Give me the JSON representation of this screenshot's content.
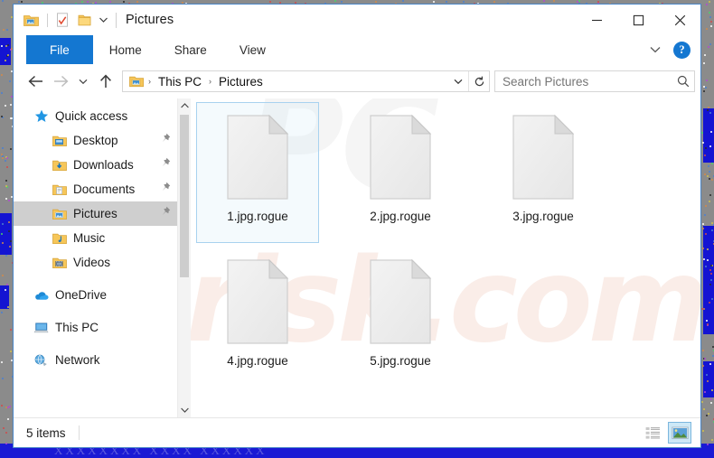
{
  "window": {
    "title": "Pictures",
    "quick_access_toolbar": [
      {
        "name": "pictures-folder-icon",
        "label": "Pictures"
      },
      {
        "name": "properties-icon",
        "label": "Properties"
      },
      {
        "name": "new-folder-icon",
        "label": "New folder"
      },
      {
        "name": "customize-caret-icon",
        "label": "Customize Quick Access Toolbar"
      }
    ],
    "controls": {
      "minimize": "–",
      "maximize": "□",
      "close": "✕"
    }
  },
  "ribbon": {
    "tabs": [
      {
        "label": "File",
        "active": true
      },
      {
        "label": "Home",
        "active": false
      },
      {
        "label": "Share",
        "active": false
      },
      {
        "label": "View",
        "active": false
      }
    ],
    "expand_label": "⌄",
    "help_label": "?"
  },
  "addressbar": {
    "back_label": "←",
    "forward_label": "→",
    "recent_label": "⌄",
    "up_label": "↑",
    "breadcrumb": [
      {
        "label": "This PC"
      },
      {
        "label": "Pictures"
      }
    ],
    "separator": "›",
    "dropdown_label": "⌄",
    "refresh_label": "↻"
  },
  "search": {
    "placeholder": "Search Pictures",
    "value": "",
    "icon": "search-icon"
  },
  "sidebar": {
    "items": [
      {
        "label": "Quick access",
        "icon": "star-icon",
        "indent": false,
        "pinned": false,
        "selected": false
      },
      {
        "label": "Desktop",
        "icon": "desktop-folder-icon",
        "indent": true,
        "pinned": true,
        "selected": false
      },
      {
        "label": "Downloads",
        "icon": "downloads-folder-icon",
        "indent": true,
        "pinned": true,
        "selected": false
      },
      {
        "label": "Documents",
        "icon": "documents-folder-icon",
        "indent": true,
        "pinned": true,
        "selected": false
      },
      {
        "label": "Pictures",
        "icon": "pictures-folder-icon",
        "indent": true,
        "pinned": true,
        "selected": true
      },
      {
        "label": "Music",
        "icon": "music-folder-icon",
        "indent": true,
        "pinned": false,
        "selected": false
      },
      {
        "label": "Videos",
        "icon": "videos-folder-icon",
        "indent": true,
        "pinned": false,
        "selected": false
      },
      {
        "label": "OneDrive",
        "icon": "onedrive-cloud-icon",
        "indent": false,
        "pinned": false,
        "selected": false,
        "gap_before": true
      },
      {
        "label": "This PC",
        "icon": "this-pc-icon",
        "indent": false,
        "pinned": false,
        "selected": false,
        "gap_before": true
      },
      {
        "label": "Network",
        "icon": "network-icon",
        "indent": false,
        "pinned": false,
        "selected": false,
        "gap_before": true
      }
    ],
    "scroll_up": "⌃",
    "scroll_down": "⌄"
  },
  "files": [
    {
      "name": "1.jpg.rogue",
      "icon": "blank-document-icon",
      "selected": true
    },
    {
      "name": "2.jpg.rogue",
      "icon": "blank-document-icon",
      "selected": false
    },
    {
      "name": "3.jpg.rogue",
      "icon": "blank-document-icon",
      "selected": false
    },
    {
      "name": "4.jpg.rogue",
      "icon": "blank-document-icon",
      "selected": false
    },
    {
      "name": "5.jpg.rogue",
      "icon": "blank-document-icon",
      "selected": false
    }
  ],
  "statusbar": {
    "item_count": "5 items",
    "views": [
      {
        "name": "details-view-button",
        "active": false
      },
      {
        "name": "large-icons-view-button",
        "active": true
      }
    ]
  },
  "watermark": {
    "text_front": "risk.com",
    "text_back": "PC"
  },
  "colors": {
    "accent": "#1477d1",
    "selection": "#cde8f7",
    "selection_border": "#7cb7de",
    "sidebar_selected": "#cfcfcf",
    "desktop": "#8b8b8b",
    "taskbar_blue": "#1a1ad4"
  }
}
